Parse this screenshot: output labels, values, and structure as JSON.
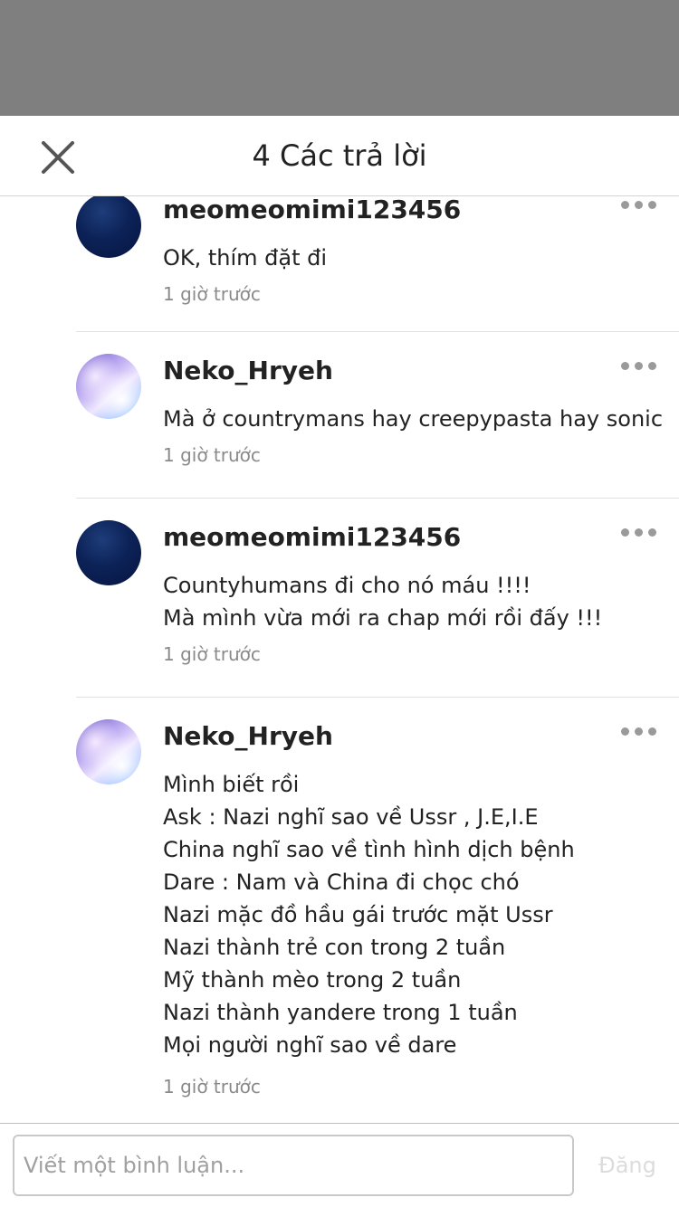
{
  "header": {
    "title": "4 Các trả lời"
  },
  "replies": [
    {
      "username": "meomeomimi123456",
      "lines": [
        "OK, thím đặt đi"
      ],
      "time": "1 giờ trước",
      "avatar": "dark-night-sky-avatar"
    },
    {
      "username": "Neko_Hryeh",
      "lines": [
        "Mà ở countrymans hay creepypasta hay sonic"
      ],
      "time": "1 giờ trước",
      "avatar": "anime-girl-avatar"
    },
    {
      "username": "meomeomimi123456",
      "lines": [
        "Countyhumans đi cho nó máu !!!!",
        "Mà mình vừa mới ra chap mới rồi đấy !!!"
      ],
      "time": "1 giờ trước",
      "avatar": "dark-night-sky-avatar"
    },
    {
      "username": "Neko_Hryeh",
      "lines": [
        "Mình biết rồi",
        "Ask : Nazi nghĩ sao về Ussr , J.E,I.E",
        "China nghĩ sao về tình hình dịch bệnh",
        "Dare : Nam và China đi chọc chó",
        "Nazi mặc đồ hầu gái trước mặt Ussr",
        "Nazi thành trẻ con trong 2 tuần",
        "Mỹ thành mèo trong 2 tuần",
        "Nazi thành yandere trong 1 tuần",
        "Mọi người nghĩ sao về dare"
      ],
      "time": "1 giờ trước",
      "avatar": "anime-girl-avatar"
    }
  ],
  "composer": {
    "placeholder": "Viết một bình luận...",
    "post_label": "Đăng"
  },
  "icons": {
    "close": "close-icon",
    "more": "more-options-icon"
  },
  "colors": {
    "overlay": "#7f7f7f",
    "text": "#222222",
    "muted": "#8a8a8a",
    "post_disabled": "#dcdcdc"
  }
}
